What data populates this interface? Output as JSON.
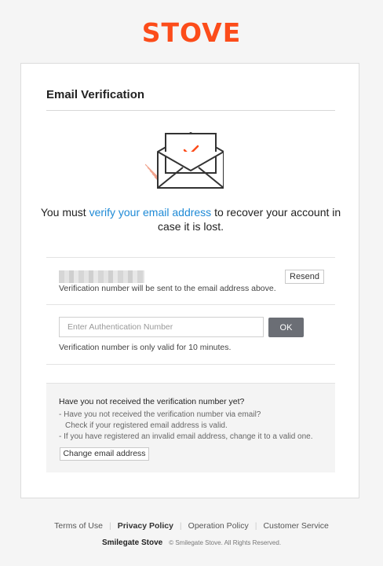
{
  "brand": {
    "logo_text": "STOVE",
    "logo_color": "#fc4c1a"
  },
  "card": {
    "title": "Email Verification"
  },
  "message": {
    "prefix": "You must ",
    "link": "verify your email address",
    "suffix": " to recover your account in case it is lost.",
    "link_color": "#1e8ad6"
  },
  "email_section": {
    "email_value": "",
    "resend_label": "Resend",
    "note": "Verification number will be sent to the email address above."
  },
  "auth_section": {
    "placeholder": "Enter Authentication Number",
    "ok_label": "OK",
    "note": "Verification number is only valid for 10 minutes."
  },
  "help": {
    "title": "Have you not received the verification number yet?",
    "items": [
      "- Have you not received the verification number via email?",
      "Check if your registered email address is valid.",
      "- If you have registered an invalid email address, change it to a valid one."
    ],
    "change_email_label": "Change email address"
  },
  "footer": {
    "links": [
      "Terms of Use",
      "Privacy Policy",
      "Operation Policy",
      "Customer Service"
    ],
    "brand": "Smilegate Stove",
    "copyright": "© Smilegate Stove. All Rights Reserved."
  },
  "icons": {
    "envelope": "envelope-check-icon"
  }
}
